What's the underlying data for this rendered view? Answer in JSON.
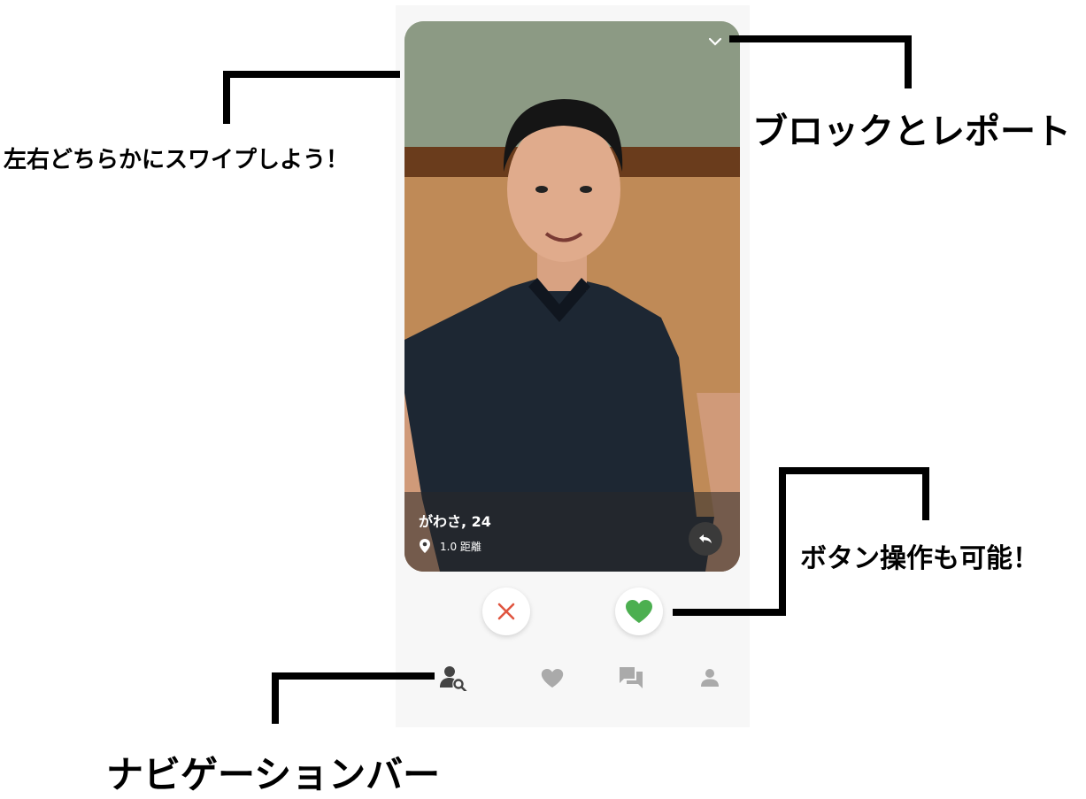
{
  "profile": {
    "name_age": "がわさ, 24",
    "distance": "1.0 距離"
  },
  "icons": {
    "chevron": "chevron-down-icon",
    "location": "location-pin-icon",
    "undo": "undo-icon",
    "dislike": "close-icon",
    "like": "heart-icon",
    "nav_search": "person-search-icon",
    "nav_likes": "heart-icon",
    "nav_chat": "chat-icon",
    "nav_profile": "person-icon"
  },
  "colors": {
    "dislike": "#e0553f",
    "like": "#4caf50",
    "nav_active": "#444444",
    "nav_inactive": "#aaaaaa"
  },
  "annotations": {
    "swipe": "左右どちらかにスワイプしよう！",
    "block_report": "ブロックとレポート",
    "buttons": "ボタン操作も可能！",
    "nav_bar": "ナビゲーションバー"
  }
}
